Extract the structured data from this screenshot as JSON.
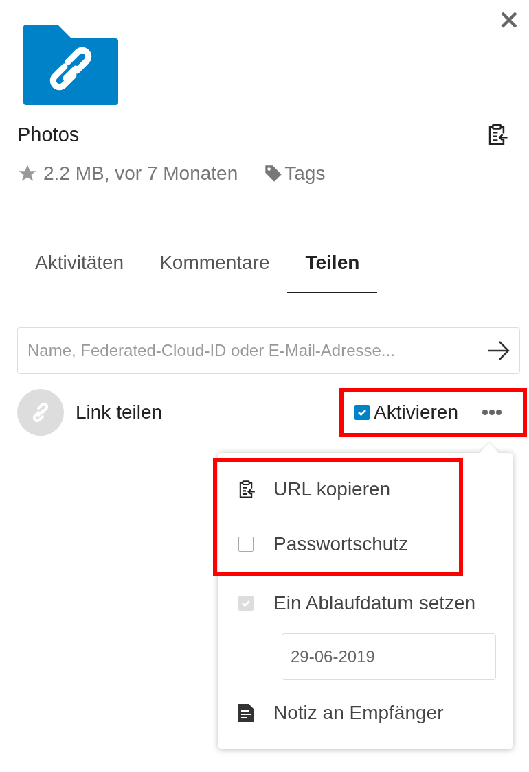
{
  "file": {
    "name": "Photos",
    "favorite": false,
    "meta": "2.2 MB, vor 7 Monaten",
    "tags_label": "Tags"
  },
  "tabs": [
    {
      "label": "Aktivitäten",
      "selected": false
    },
    {
      "label": "Kommentare",
      "selected": false
    },
    {
      "label": "Teilen",
      "selected": true
    }
  ],
  "share_search": {
    "placeholder": "Name, Federated-Cloud-ID oder E-Mail-Adresse..."
  },
  "share_link": {
    "label": "Link teilen",
    "enable": {
      "label": "Aktivieren",
      "checked": true
    },
    "highlighted": true
  },
  "menu": {
    "items": [
      {
        "kind": "action",
        "label": "URL kopieren",
        "highlighted": true
      },
      {
        "kind": "checkbox",
        "label": "Passwortschutz",
        "checked": false,
        "disabled": false,
        "highlighted": true
      },
      {
        "kind": "checkbox",
        "label": "Ein Ablaufdatum setzen",
        "checked": true,
        "disabled": true,
        "highlighted": false
      },
      {
        "kind": "date",
        "value": "29-06-2019",
        "highlighted": false
      },
      {
        "kind": "note",
        "label": "Notiz an Empfänger",
        "highlighted": false
      }
    ]
  }
}
